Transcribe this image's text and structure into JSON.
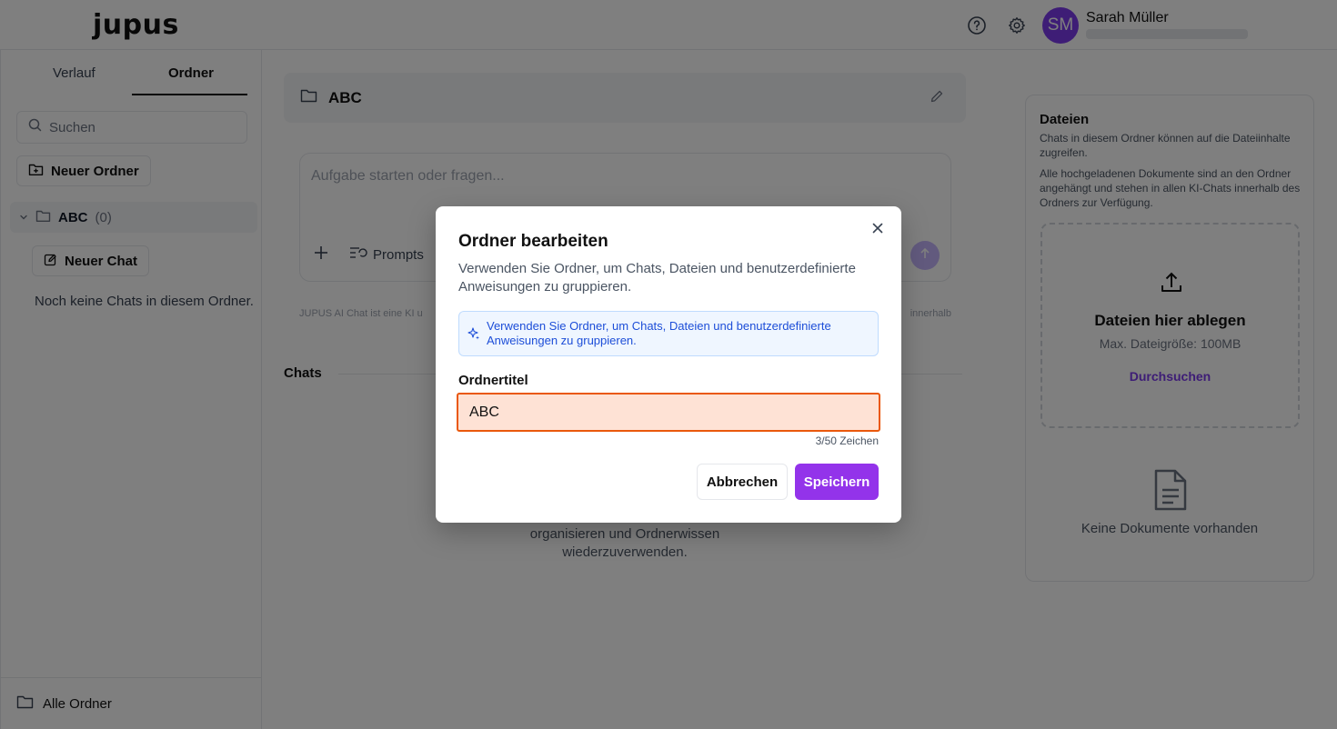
{
  "header": {
    "logo": "jupus",
    "user_initials": "SM",
    "user_name": "Sarah Müller",
    "icons": [
      "help-icon",
      "gear-icon"
    ]
  },
  "sidebar": {
    "tabs": [
      {
        "label": "Verlauf",
        "active": false
      },
      {
        "label": "Ordner",
        "active": true
      }
    ],
    "search_placeholder": "Suchen",
    "new_folder_label": "Neuer Ordner",
    "folder": {
      "name": "ABC",
      "count": "(0)"
    },
    "new_chat_label": "Neuer Chat",
    "empty_text": "Noch keine Chats in diesem Ordner.",
    "all_folders_label": "Alle Ordner"
  },
  "main": {
    "folder_title": "ABC",
    "prompt_placeholder": "Aufgabe starten oder fragen...",
    "prompts_label": "Prompts",
    "disclaimer_left": "JUPUS AI Chat ist eine KI u",
    "disclaimer_right": "innerhalb",
    "chats_heading": "Chats",
    "empty_text_line1": "organisieren und Ordnerwissen",
    "empty_text_line2": "wiederzuverwenden."
  },
  "files_panel": {
    "title": "Dateien",
    "desc1": "Chats in diesem Ordner können auf die Dateiinhalte zugreifen.",
    "desc2": "Alle hochgeladenen Dokumente sind an den Ordner angehängt und stehen in allen KI-Chats innerhalb des Ordners zur Verfügung.",
    "drop_title": "Dateien hier ablegen",
    "drop_sub": "Max. Dateigröße: 100MB",
    "browse_label": "Durchsuchen",
    "no_docs": "Keine Dokumente vorhanden"
  },
  "modal": {
    "title": "Ordner bearbeiten",
    "description": "Verwenden Sie Ordner, um Chats, Dateien und benutzerdefinierte Anweisungen zu gruppieren.",
    "info_text": "Verwenden Sie Ordner, um Chats, Dateien und benutzerdefinierte Anweisungen zu gruppieren.",
    "field_label": "Ordnertitel",
    "field_value": "ABC",
    "char_count": "3/50 Zeichen",
    "cancel_label": "Abbrechen",
    "save_label": "Speichern"
  },
  "colors": {
    "accent": "#9333ea",
    "avatar": "#7c3aed",
    "input_error_border": "#ea580c",
    "input_error_bg": "#fee2d5",
    "info_bg": "#eff6ff",
    "info_text": "#1d4ed8"
  }
}
